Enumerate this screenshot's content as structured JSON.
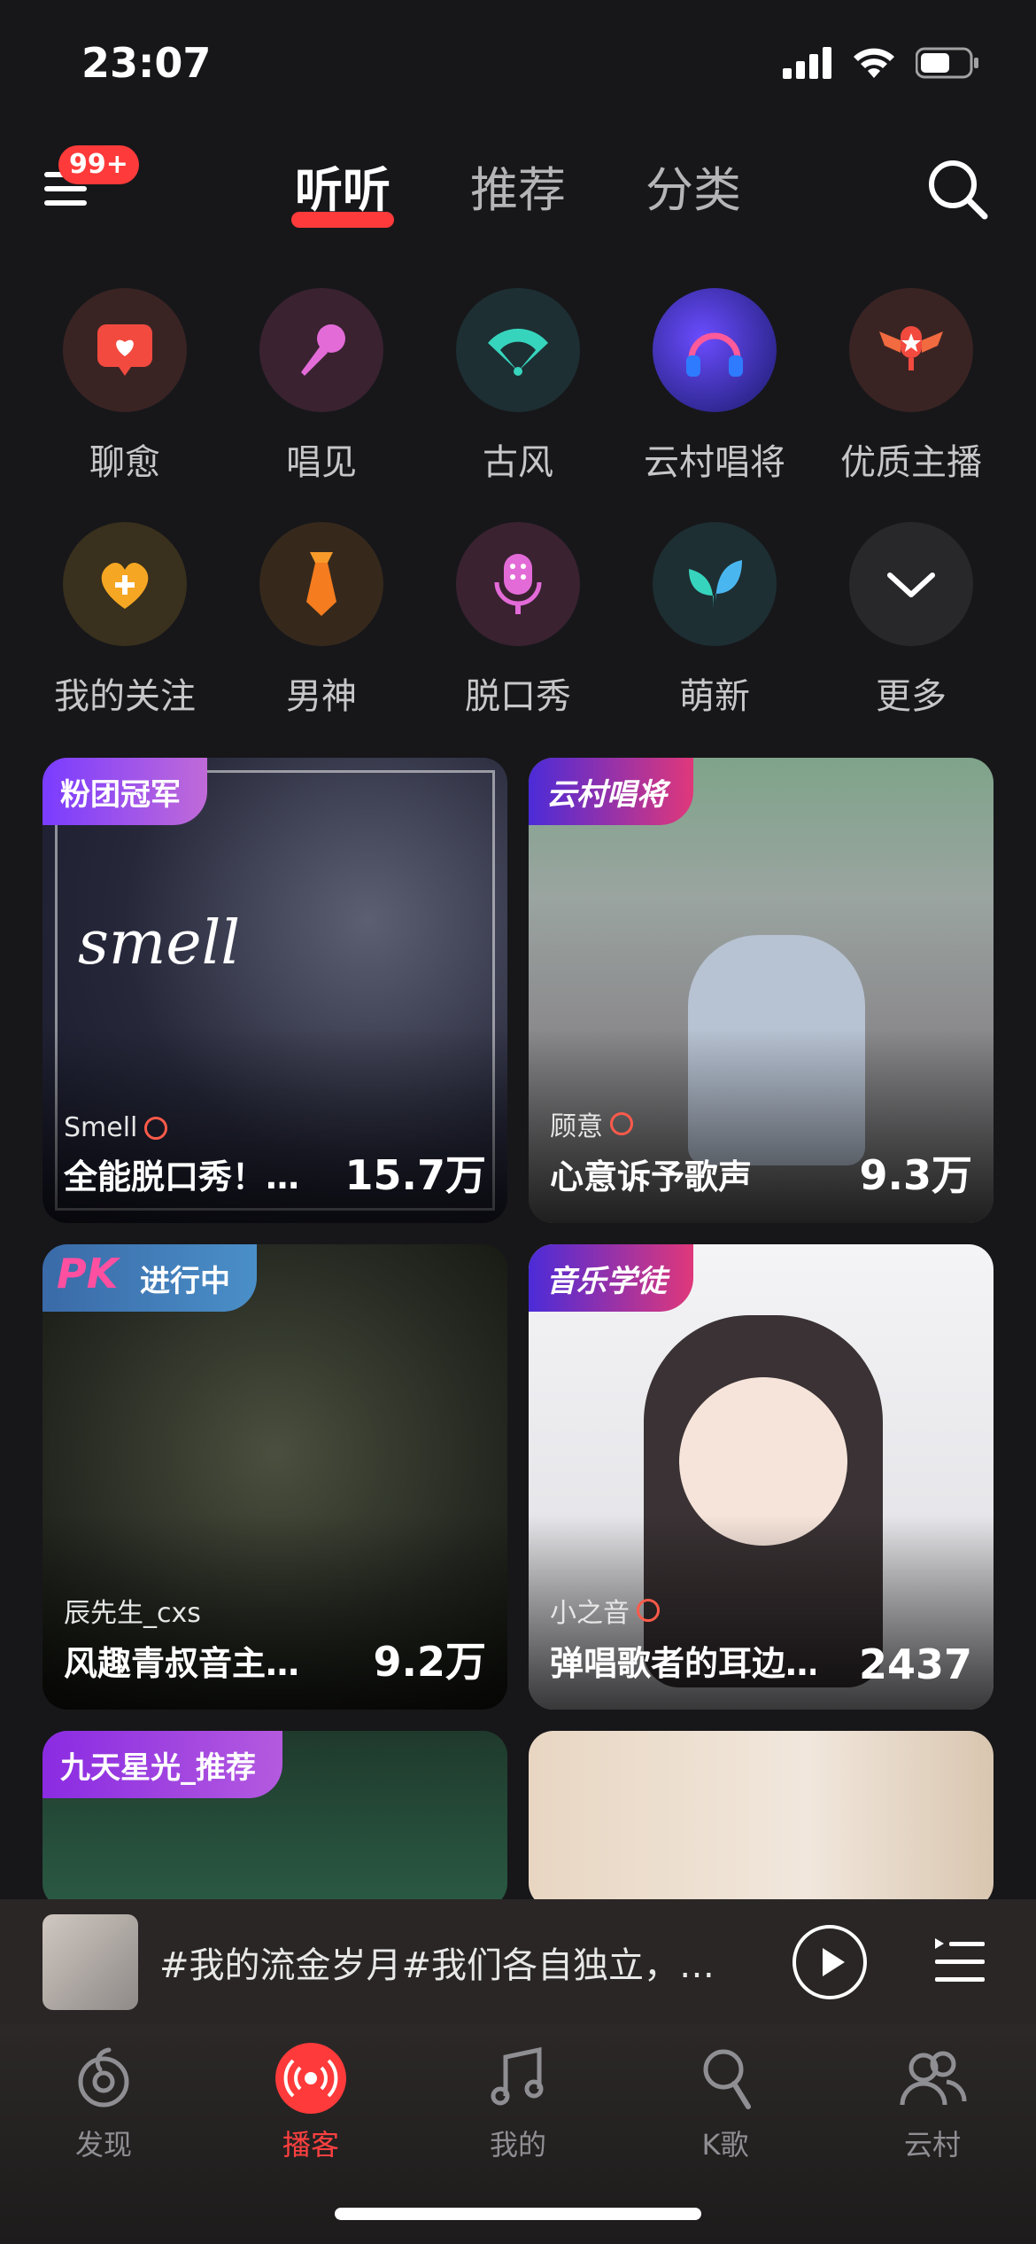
{
  "status_bar": {
    "time": "23:07"
  },
  "header": {
    "badge": "99+",
    "tabs": [
      {
        "label": "听听",
        "active": true
      },
      {
        "label": "推荐",
        "active": false
      },
      {
        "label": "分类",
        "active": false
      }
    ]
  },
  "categories": [
    {
      "label": "聊愈",
      "icon": "heart-chat-icon",
      "bg": "#3a2423"
    },
    {
      "label": "唱见",
      "icon": "microphone-icon",
      "bg": "#3a2231"
    },
    {
      "label": "古风",
      "icon": "fan-icon",
      "bg": "#1d2f33"
    },
    {
      "label": "云村唱将",
      "icon": "headphones-icon",
      "bg": "#2a2a5a"
    },
    {
      "label": "优质主播",
      "icon": "winged-mic-icon",
      "bg": "#3a2423"
    },
    {
      "label": "我的关注",
      "icon": "heart-plus-icon",
      "bg": "#39301d"
    },
    {
      "label": "男神",
      "icon": "necktie-icon",
      "bg": "#36291c"
    },
    {
      "label": "脱口秀",
      "icon": "podcast-mic-icon",
      "bg": "#3a2231"
    },
    {
      "label": "萌新",
      "icon": "sprout-icon",
      "bg": "#1d2f33"
    },
    {
      "label": "更多",
      "icon": "chevron-down-icon",
      "bg": "#28282b"
    }
  ],
  "cards": [
    {
      "tag": "粉团冠军",
      "author": "Smell",
      "title": "全能脱口秀！…",
      "count": "15.7万"
    },
    {
      "tag": "云村唱将",
      "author": "顾意",
      "title": "心意诉予歌声",
      "count": "9.3万"
    },
    {
      "tag": "进行中",
      "author": "辰先生_cxs",
      "title": "风趣青叔音主…",
      "count": "9.2万"
    },
    {
      "tag": "音乐学徒",
      "author": "小之音",
      "title": "弹唱歌者的耳边…",
      "count": "2437"
    },
    {
      "tag": "九天星光_推荐"
    },
    {
      "tag": ""
    }
  ],
  "player": {
    "song": "#我的流金岁月#我们各自独立，…"
  },
  "tabbar": [
    {
      "label": "发现",
      "icon": "netease-logo-icon",
      "active": false
    },
    {
      "label": "播客",
      "icon": "broadcast-icon",
      "active": true
    },
    {
      "label": "我的",
      "icon": "music-note-icon",
      "active": false
    },
    {
      "label": "K歌",
      "icon": "karaoke-mic-icon",
      "active": false
    },
    {
      "label": "云村",
      "icon": "people-icon",
      "active": false
    }
  ],
  "colors": {
    "accent": "#ff3a3a",
    "background": "#17171a"
  }
}
